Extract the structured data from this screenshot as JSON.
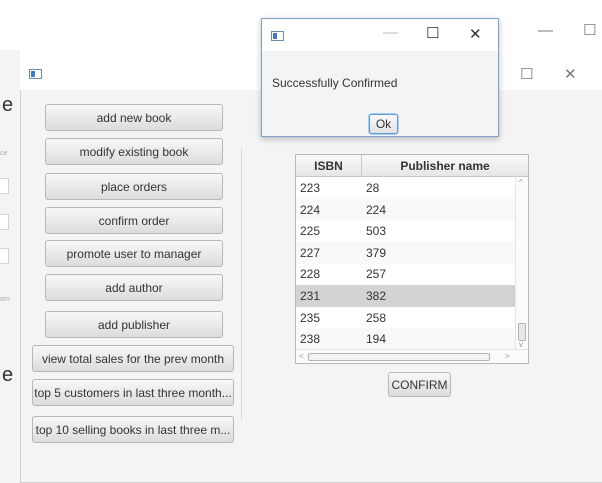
{
  "background_window": {
    "ghost_letters": [
      "e",
      "e"
    ],
    "ghost_fragments": [
      "ce",
      "om"
    ],
    "controls": [
      "—",
      "☐"
    ]
  },
  "main_window": {
    "controls": [
      "☐",
      "✕"
    ],
    "sidebar_buttons": [
      "add new book",
      "modify existing book",
      "place orders",
      "confirm order",
      "promote user to manager",
      "add author",
      "add publisher",
      "view total sales for the prev month",
      "top 5 customers in last three month...",
      "top 10 selling books in last three m..."
    ],
    "table": {
      "columns": [
        "ISBN",
        "Publisher name"
      ],
      "rows": [
        {
          "isbn": "223",
          "publisher": "28"
        },
        {
          "isbn": "224",
          "publisher": "224"
        },
        {
          "isbn": "225",
          "publisher": "503"
        },
        {
          "isbn": "227",
          "publisher": "379"
        },
        {
          "isbn": "228",
          "publisher": "257"
        },
        {
          "isbn": "231",
          "publisher": "382"
        },
        {
          "isbn": "235",
          "publisher": "258"
        },
        {
          "isbn": "238",
          "publisher": "194"
        }
      ],
      "selected_row_index": 5,
      "scroll_arrows": {
        "up": "^",
        "down": "v",
        "left": "<",
        "right": ">"
      }
    },
    "confirm_label": "CONFIRM"
  },
  "dialog": {
    "controls": [
      "—",
      "☐",
      "✕"
    ],
    "message": "Successfully Confirmed",
    "ok_label": "Ok"
  },
  "colors": {
    "selected_row": "#d3d3d3",
    "alt_row": "#f9f9f9",
    "dialog_border": "#7fa2c8",
    "ok_focus": "#5c9ad6"
  }
}
